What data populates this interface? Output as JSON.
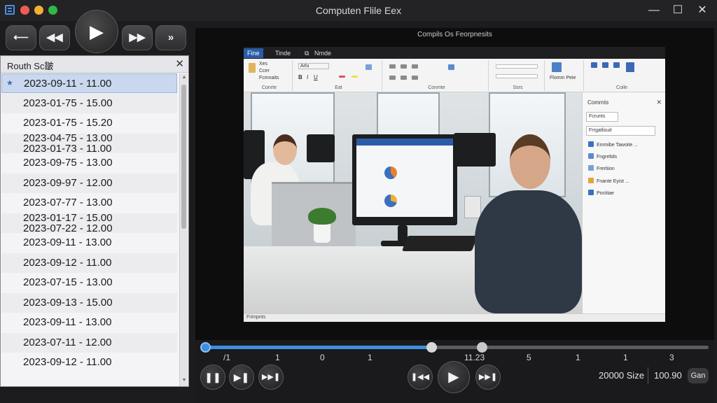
{
  "window": {
    "title": "Computen Flile Eex",
    "minimize_glyph": "—",
    "maximize_glyph": "☐",
    "close_glyph": "✕"
  },
  "left_controls": {
    "back_glyph": "⟵",
    "rewind_glyph": "◀◀",
    "play_glyph": "▶",
    "forward_glyph": "▶▶",
    "next_glyph": "»"
  },
  "sidebar": {
    "title": "Routh Sc皺",
    "close_glyph": "✕",
    "rows": [
      {
        "lines": [
          "2023-09-11 - 11.00"
        ],
        "selected": true
      },
      {
        "lines": [
          "2023-01-75 - 15.00"
        ]
      },
      {
        "lines": [
          "2023-01-75 - 15.20"
        ]
      },
      {
        "lines": [
          "2023-04-75 - 13.00",
          "2023-01-73 - 11.00"
        ]
      },
      {
        "lines": [
          "2023-09-75 - 13.00"
        ]
      },
      {
        "lines": [
          "2023-09-97 - 12.00"
        ]
      },
      {
        "lines": [
          "2023-07-77 - 13.00"
        ]
      },
      {
        "lines": [
          "2023-01-17 - 15.00",
          "2023-07-22 - 12.00"
        ]
      },
      {
        "lines": [
          "2023-09-11 - 13.00"
        ]
      },
      {
        "lines": [
          "2023-09-12 - 11.00"
        ]
      },
      {
        "lines": [
          "2023-07-15 - 13.00"
        ]
      },
      {
        "lines": [
          "2023-09-13 - 15.00"
        ]
      },
      {
        "lines": [
          "2023-09-11 - 13.00"
        ]
      },
      {
        "lines": [
          "2023-07-11 - 12.00"
        ]
      },
      {
        "lines": [
          "2023-09-12 - 11.00"
        ]
      }
    ]
  },
  "viewer": {
    "caption": "Compils Os Feorpnesits"
  },
  "document_frame": {
    "tabs": [
      "Fine",
      "Tinde",
      "Nmde"
    ],
    "ribbon_groups": [
      "Conrte",
      "Eat",
      "Conmte",
      "Ssrs",
      "Coile"
    ],
    "ribbon_texts": [
      "Xes",
      "Ccer",
      "Fcmnaits",
      "Arlu",
      "Flomm Peie"
    ],
    "pane": {
      "title": "Comrnts",
      "tab": "Fcrunts",
      "search": "Frrgatlisuit",
      "items": [
        "Emmibe Tawoite ...",
        "Fngreltds",
        "Frertiion",
        "Fnante Eyist ...",
        "Pocitiae"
      ]
    },
    "status_left": "Frimpnts"
  },
  "playback": {
    "progress": 0.45,
    "buffered": 0.55,
    "tick_labels": [
      "/1",
      "1",
      "0",
      "1",
      "11.23",
      "5",
      "1",
      "1",
      "3"
    ],
    "pause_glyph": "❚❚",
    "step_glyph": "▶❚",
    "skip_glyph": "▶▶❚",
    "prev_glyph": "❚◀◀",
    "play_glyph": "▶",
    "next_glyph": "▶▶❚",
    "size_label": "20000 Size",
    "rate_label": "100.90",
    "cc_label": "Gan"
  },
  "colors": {
    "accent": "#3d8ee0",
    "selection": "#c9d8ee",
    "ribbon_active": "#2a5da8"
  }
}
